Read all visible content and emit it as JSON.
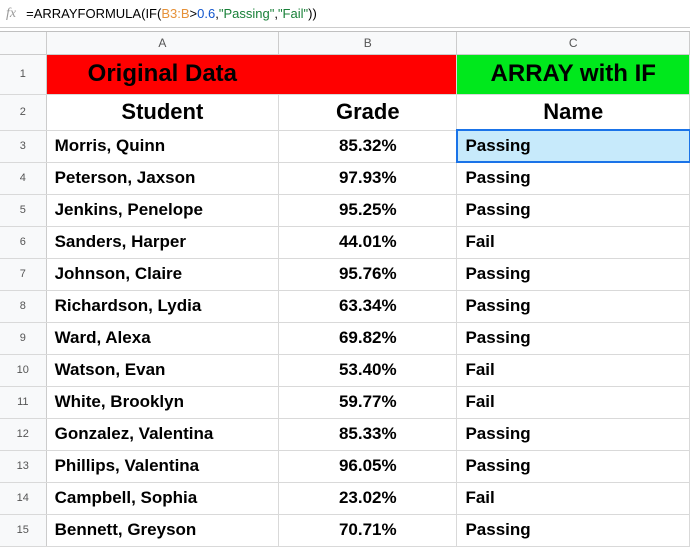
{
  "formula_bar": {
    "fx_label": "fx",
    "parts": {
      "eq": "=",
      "fn1": "ARRAYFORMULA",
      "open1": "(",
      "fn2": "IF",
      "open2": "(",
      "ref": "B3:B",
      "gt": ">",
      "num": "0.6",
      "comma1": ",",
      "str1": "\"Passing\"",
      "comma2": ",",
      "str2": "\"Fail\"",
      "close": "))"
    }
  },
  "columns": {
    "A": "A",
    "B": "B",
    "C": "C"
  },
  "row_labels": [
    "1",
    "2",
    "3",
    "4",
    "5",
    "6",
    "7",
    "8",
    "9",
    "10",
    "11",
    "12",
    "13",
    "14",
    "15"
  ],
  "headers": {
    "original_data": "Original Data",
    "array_with_if": "ARRAY with IF",
    "student": "Student",
    "grade": "Grade",
    "name": "Name"
  },
  "rows": [
    {
      "student": "Morris, Quinn",
      "grade": "85.32%",
      "result": "Passing"
    },
    {
      "student": "Peterson, Jaxson",
      "grade": "97.93%",
      "result": "Passing"
    },
    {
      "student": "Jenkins, Penelope",
      "grade": "95.25%",
      "result": "Passing"
    },
    {
      "student": "Sanders, Harper",
      "grade": "44.01%",
      "result": "Fail"
    },
    {
      "student": "Johnson, Claire",
      "grade": "95.76%",
      "result": "Passing"
    },
    {
      "student": "Richardson, Lydia",
      "grade": "63.34%",
      "result": "Passing"
    },
    {
      "student": "Ward, Alexa",
      "grade": "69.82%",
      "result": "Passing"
    },
    {
      "student": "Watson, Evan",
      "grade": "53.40%",
      "result": "Fail"
    },
    {
      "student": "White, Brooklyn",
      "grade": "59.77%",
      "result": "Fail"
    },
    {
      "student": "Gonzalez, Valentina",
      "grade": "85.33%",
      "result": "Passing"
    },
    {
      "student": "Phillips, Valentina",
      "grade": "96.05%",
      "result": "Passing"
    },
    {
      "student": "Campbell, Sophia",
      "grade": "23.02%",
      "result": "Fail"
    },
    {
      "student": "Bennett, Greyson",
      "grade": "70.71%",
      "result": "Passing"
    }
  ],
  "selected_cell": "C3",
  "colors": {
    "red": "#ff0000",
    "green": "#00e81c",
    "selection": "#c7eafb"
  },
  "chart_data": {
    "type": "table",
    "columns": [
      "Student",
      "Grade",
      "ARRAY with IF (Name)"
    ],
    "rows": [
      [
        "Morris, Quinn",
        "85.32%",
        "Passing"
      ],
      [
        "Peterson, Jaxson",
        "97.93%",
        "Passing"
      ],
      [
        "Jenkins, Penelope",
        "95.25%",
        "Passing"
      ],
      [
        "Sanders, Harper",
        "44.01%",
        "Fail"
      ],
      [
        "Johnson, Claire",
        "95.76%",
        "Passing"
      ],
      [
        "Richardson, Lydia",
        "63.34%",
        "Passing"
      ],
      [
        "Ward, Alexa",
        "69.82%",
        "Passing"
      ],
      [
        "Watson, Evan",
        "53.40%",
        "Fail"
      ],
      [
        "White, Brooklyn",
        "59.77%",
        "Fail"
      ],
      [
        "Gonzalez, Valentina",
        "85.33%",
        "Passing"
      ],
      [
        "Phillips, Valentina",
        "96.05%",
        "Passing"
      ],
      [
        "Campbell, Sophia",
        "23.02%",
        "Fail"
      ],
      [
        "Bennett, Greyson",
        "70.71%",
        "Passing"
      ]
    ]
  }
}
